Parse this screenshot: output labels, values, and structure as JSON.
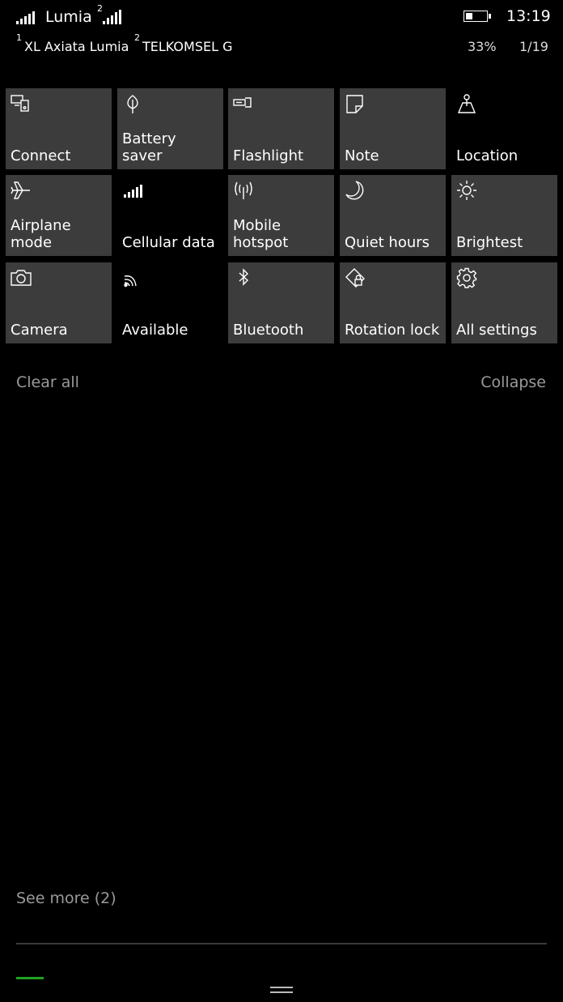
{
  "status_bar": {
    "sim1_carrier": "Lumia",
    "sim2_index": "2",
    "sim1_index": "1",
    "sim1_operator": "XL Axiata Lumia",
    "sim2_index_b": "2",
    "sim2_operator": "TELKOMSEL G",
    "time": "13:19",
    "battery_percent": "33%",
    "battery_level": 0.33,
    "date": "1/19"
  },
  "tiles": [
    {
      "label": "Connect",
      "icon": "connect-icon",
      "active": true
    },
    {
      "label": "Battery\nsaver",
      "icon": "leaf-icon",
      "active": true
    },
    {
      "label": "Flashlight",
      "icon": "flashlight-icon",
      "active": true
    },
    {
      "label": "Note",
      "icon": "note-icon",
      "active": true
    },
    {
      "label": "Location",
      "icon": "location-icon",
      "active": false
    },
    {
      "label": "Airplane\nmode",
      "icon": "airplane-icon",
      "active": true
    },
    {
      "label": "Cellular data",
      "icon": "cellular-icon",
      "active": false
    },
    {
      "label": "Mobile\nhotspot",
      "icon": "hotspot-icon",
      "active": true
    },
    {
      "label": "Quiet hours",
      "icon": "moon-icon",
      "active": true
    },
    {
      "label": "Brightest",
      "icon": "sun-icon",
      "active": true
    },
    {
      "label": "Camera",
      "icon": "camera-icon",
      "active": true
    },
    {
      "label": "Available",
      "icon": "wifi-icon",
      "active": false
    },
    {
      "label": "Bluetooth",
      "icon": "bluetooth-icon",
      "active": true
    },
    {
      "label": "Rotation lock",
      "icon": "rotation-lock-icon",
      "active": true
    },
    {
      "label": "All settings",
      "icon": "gear-icon",
      "active": true
    }
  ],
  "actions": {
    "clear_all": "Clear all",
    "collapse": "Collapse",
    "see_more": "See more (2)"
  },
  "colors": {
    "background": "#000000",
    "tile_active": "#3c3c3c",
    "link": "#9a9a9a",
    "accent": "#1fa31f"
  }
}
